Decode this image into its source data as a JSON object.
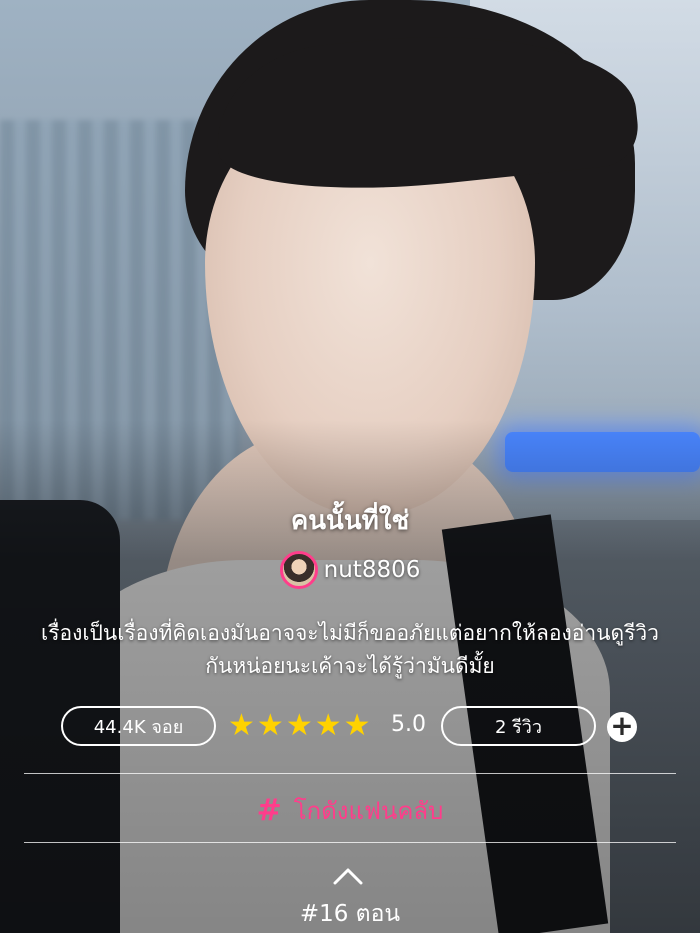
{
  "story": {
    "title": "คนนั้นที่ใช่",
    "author": "nut8806",
    "description": "เรื่องเป็นเรื่องที่คิดเองมันอาจจะไม่มีก็ขออภัยแต่อยากให้ลองอ่านดูรีวิวกันหน่อยนะเค้าจะได้รู้ว่ามันดีมั้ย"
  },
  "stats": {
    "views_label": "44.4K จอย",
    "rating_value": "5.0",
    "stars_filled": 5,
    "reviews_label": "2 รีวิว",
    "add_symbol": "+"
  },
  "fanclub": {
    "icon_glyph": "#",
    "label": "โกดังแฟนคลับ"
  },
  "episodes": {
    "label": "#16 ตอน"
  },
  "colors": {
    "accent_pink": "#ff3d8b",
    "star_yellow": "#ffd200"
  },
  "icons": {
    "star": "star-icon",
    "plus": "plus-circle-icon",
    "hash": "hashtag-icon",
    "chevron": "chevron-up-icon"
  }
}
